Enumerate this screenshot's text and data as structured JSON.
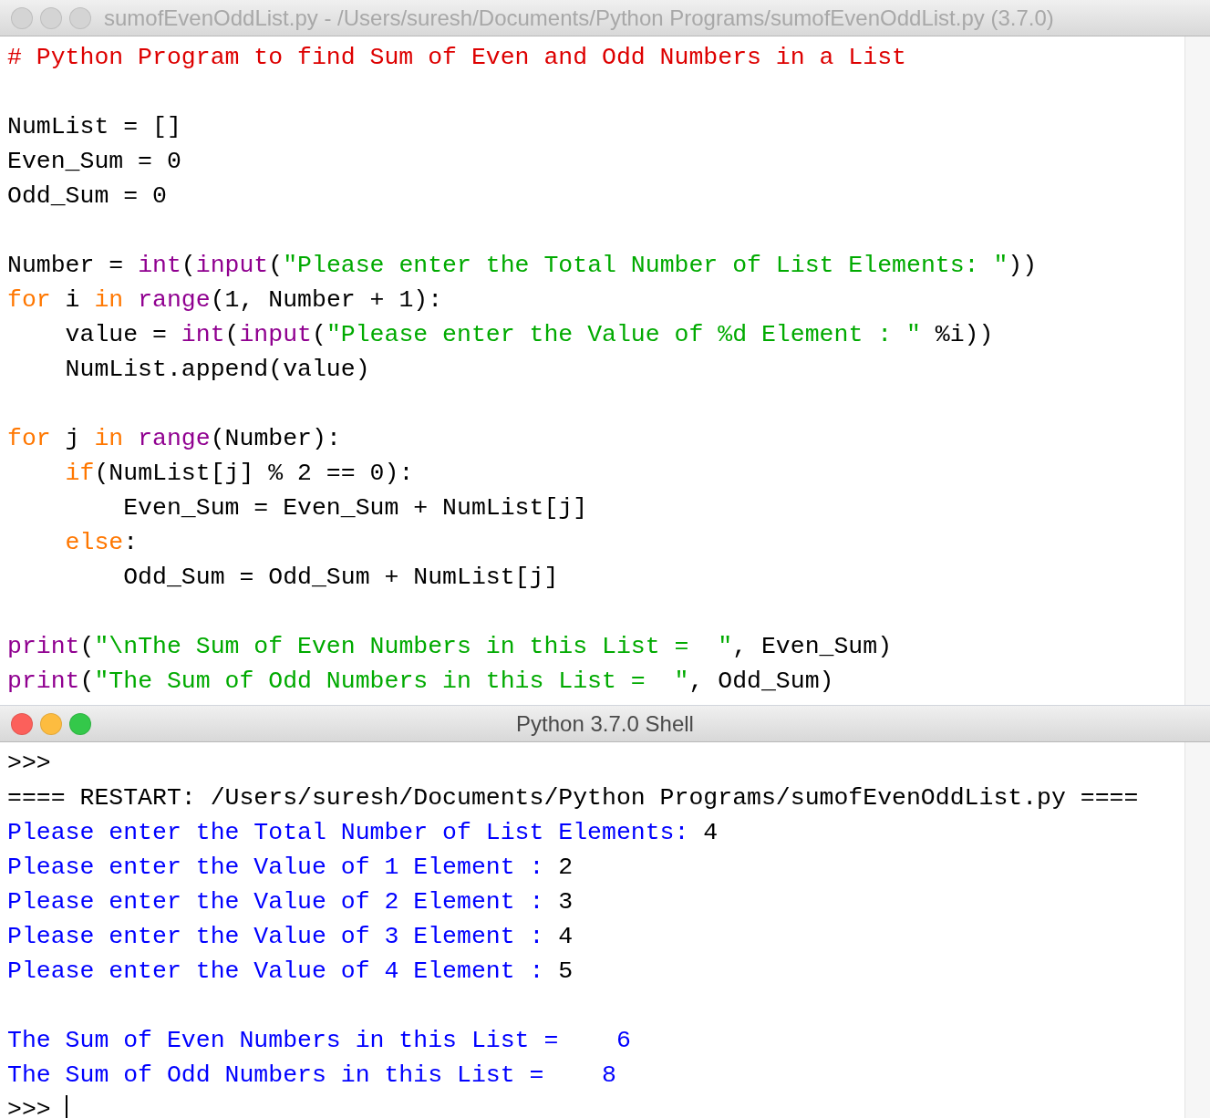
{
  "editor": {
    "title": "sumofEvenOddList.py - /Users/suresh/Documents/Python Programs/sumofEvenOddList.py (3.7.0)",
    "focused": false,
    "lines": [
      {
        "kind": "code",
        "tokens": [
          {
            "kind": "comment",
            "text": "# Python Program to find Sum of Even and Odd Numbers in a List"
          }
        ]
      },
      {
        "kind": "blank"
      },
      {
        "kind": "code",
        "tokens": [
          {
            "kind": "plain",
            "text": "NumList = []"
          }
        ]
      },
      {
        "kind": "code",
        "tokens": [
          {
            "kind": "plain",
            "text": "Even_Sum = 0"
          }
        ]
      },
      {
        "kind": "code",
        "tokens": [
          {
            "kind": "plain",
            "text": "Odd_Sum = 0"
          }
        ]
      },
      {
        "kind": "blank"
      },
      {
        "kind": "code",
        "tokens": [
          {
            "kind": "plain",
            "text": "Number = "
          },
          {
            "kind": "builtin",
            "text": "int"
          },
          {
            "kind": "plain",
            "text": "("
          },
          {
            "kind": "builtin",
            "text": "input"
          },
          {
            "kind": "plain",
            "text": "("
          },
          {
            "kind": "string",
            "text": "\"Please enter the Total Number of List Elements: \""
          },
          {
            "kind": "plain",
            "text": "))"
          }
        ]
      },
      {
        "kind": "code",
        "tokens": [
          {
            "kind": "keyword",
            "text": "for"
          },
          {
            "kind": "plain",
            "text": " i "
          },
          {
            "kind": "keyword",
            "text": "in"
          },
          {
            "kind": "builtin",
            "text": " range"
          },
          {
            "kind": "plain",
            "text": "(1, Number + 1):"
          }
        ]
      },
      {
        "kind": "code",
        "tokens": [
          {
            "kind": "plain",
            "text": "    value = "
          },
          {
            "kind": "builtin",
            "text": "int"
          },
          {
            "kind": "plain",
            "text": "("
          },
          {
            "kind": "builtin",
            "text": "input"
          },
          {
            "kind": "plain",
            "text": "("
          },
          {
            "kind": "string",
            "text": "\"Please enter the Value of %d Element : \""
          },
          {
            "kind": "plain",
            "text": " %i))"
          }
        ]
      },
      {
        "kind": "code",
        "tokens": [
          {
            "kind": "plain",
            "text": "    NumList.append(value)"
          }
        ]
      },
      {
        "kind": "blank"
      },
      {
        "kind": "code",
        "tokens": [
          {
            "kind": "keyword",
            "text": "for"
          },
          {
            "kind": "plain",
            "text": " j "
          },
          {
            "kind": "keyword",
            "text": "in"
          },
          {
            "kind": "builtin",
            "text": " range"
          },
          {
            "kind": "plain",
            "text": "(Number):"
          }
        ]
      },
      {
        "kind": "code",
        "tokens": [
          {
            "kind": "keyword",
            "text": "    if"
          },
          {
            "kind": "plain",
            "text": "(NumList[j] % 2 == 0):"
          }
        ]
      },
      {
        "kind": "code",
        "tokens": [
          {
            "kind": "plain",
            "text": "        Even_Sum = Even_Sum + NumList[j]"
          }
        ]
      },
      {
        "kind": "code",
        "tokens": [
          {
            "kind": "keyword",
            "text": "    else"
          },
          {
            "kind": "plain",
            "text": ":"
          }
        ]
      },
      {
        "kind": "code",
        "tokens": [
          {
            "kind": "plain",
            "text": "        Odd_Sum = Odd_Sum + NumList[j]"
          }
        ]
      },
      {
        "kind": "blank"
      },
      {
        "kind": "code",
        "tokens": [
          {
            "kind": "builtin",
            "text": "print"
          },
          {
            "kind": "plain",
            "text": "("
          },
          {
            "kind": "string",
            "text": "\"\\nThe Sum of Even Numbers in this List =  \""
          },
          {
            "kind": "plain",
            "text": ", Even_Sum)"
          }
        ]
      },
      {
        "kind": "code",
        "tokens": [
          {
            "kind": "builtin",
            "text": "print"
          },
          {
            "kind": "plain",
            "text": "("
          },
          {
            "kind": "string",
            "text": "\"The Sum of Odd Numbers in this List =  \""
          },
          {
            "kind": "plain",
            "text": ", Odd_Sum)"
          }
        ]
      }
    ]
  },
  "shell": {
    "title": "Python 3.7.0 Shell",
    "focused": true,
    "lines": [
      {
        "kind": "code",
        "tokens": [
          {
            "kind": "prompt",
            "text": ">>>"
          }
        ]
      },
      {
        "kind": "code",
        "tokens": [
          {
            "kind": "plain",
            "text": "==== RESTART: /Users/suresh/Documents/Python Programs/sumofEvenOddList.py ===="
          }
        ]
      },
      {
        "kind": "code",
        "tokens": [
          {
            "kind": "stdout",
            "text": "Please enter the Total Number of List Elements: "
          },
          {
            "kind": "input",
            "text": "4"
          }
        ]
      },
      {
        "kind": "code",
        "tokens": [
          {
            "kind": "stdout",
            "text": "Please enter the Value of 1 Element : "
          },
          {
            "kind": "input",
            "text": "2"
          }
        ]
      },
      {
        "kind": "code",
        "tokens": [
          {
            "kind": "stdout",
            "text": "Please enter the Value of 2 Element : "
          },
          {
            "kind": "input",
            "text": "3"
          }
        ]
      },
      {
        "kind": "code",
        "tokens": [
          {
            "kind": "stdout",
            "text": "Please enter the Value of 3 Element : "
          },
          {
            "kind": "input",
            "text": "4"
          }
        ]
      },
      {
        "kind": "code",
        "tokens": [
          {
            "kind": "stdout",
            "text": "Please enter the Value of 4 Element : "
          },
          {
            "kind": "input",
            "text": "5"
          }
        ]
      },
      {
        "kind": "blank"
      },
      {
        "kind": "code",
        "tokens": [
          {
            "kind": "stdout",
            "text": "The Sum of Even Numbers in this List =    6"
          }
        ]
      },
      {
        "kind": "code",
        "tokens": [
          {
            "kind": "stdout",
            "text": "The Sum of Odd Numbers in this List =    8"
          }
        ]
      },
      {
        "kind": "code",
        "cursor": true,
        "tokens": [
          {
            "kind": "prompt",
            "text": ">>> "
          }
        ]
      }
    ]
  }
}
